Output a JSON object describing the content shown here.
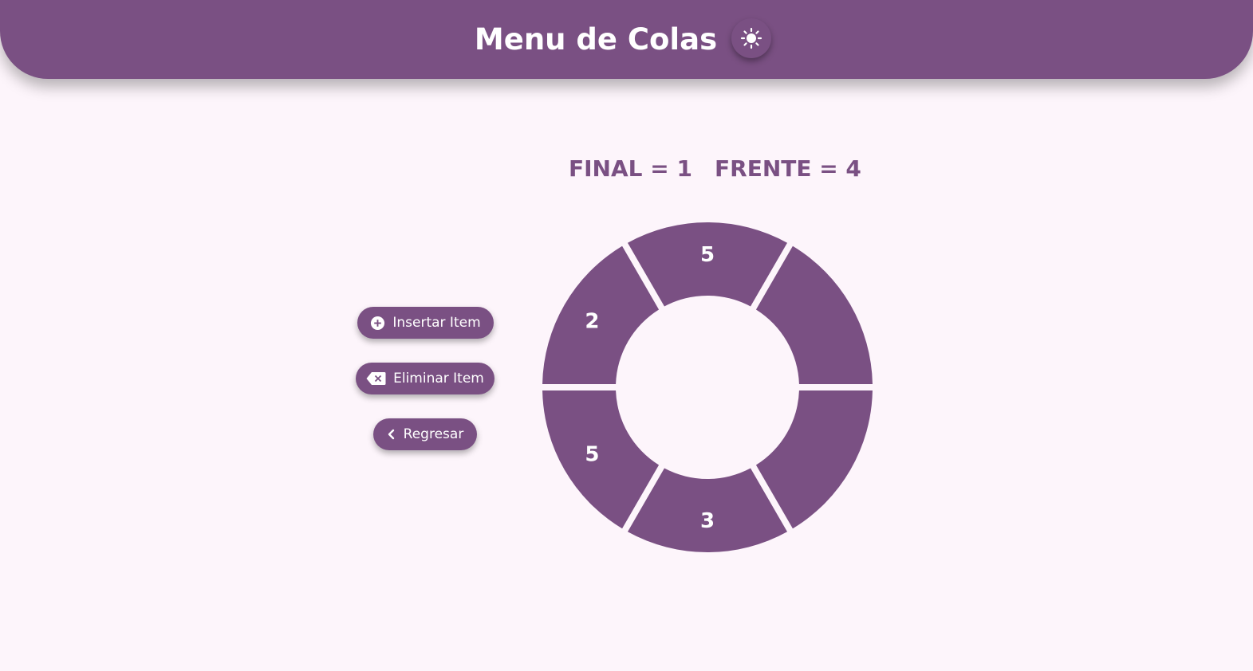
{
  "header": {
    "title": "Menu de Colas",
    "theme_toggle_icon": "sun-icon"
  },
  "status": {
    "final_text": "FINAL = 1",
    "frente_text": "FRENTE = 4"
  },
  "actions": {
    "insert_label": "Insertar Item",
    "insert_icon": "plus-circle-icon",
    "delete_label": "Eliminar Item",
    "delete_icon": "backspace-icon",
    "back_label": "Regresar",
    "back_icon": "chevron-left-icon"
  },
  "queue": {
    "slots": [
      {
        "value": "5"
      },
      {
        "value": ""
      },
      {
        "value": ""
      },
      {
        "value": "3"
      },
      {
        "value": "5"
      },
      {
        "value": "2"
      }
    ]
  },
  "colors": {
    "primary": "#7a5083",
    "background": "#fdf5fb",
    "text_on_primary": "#ffffff"
  }
}
